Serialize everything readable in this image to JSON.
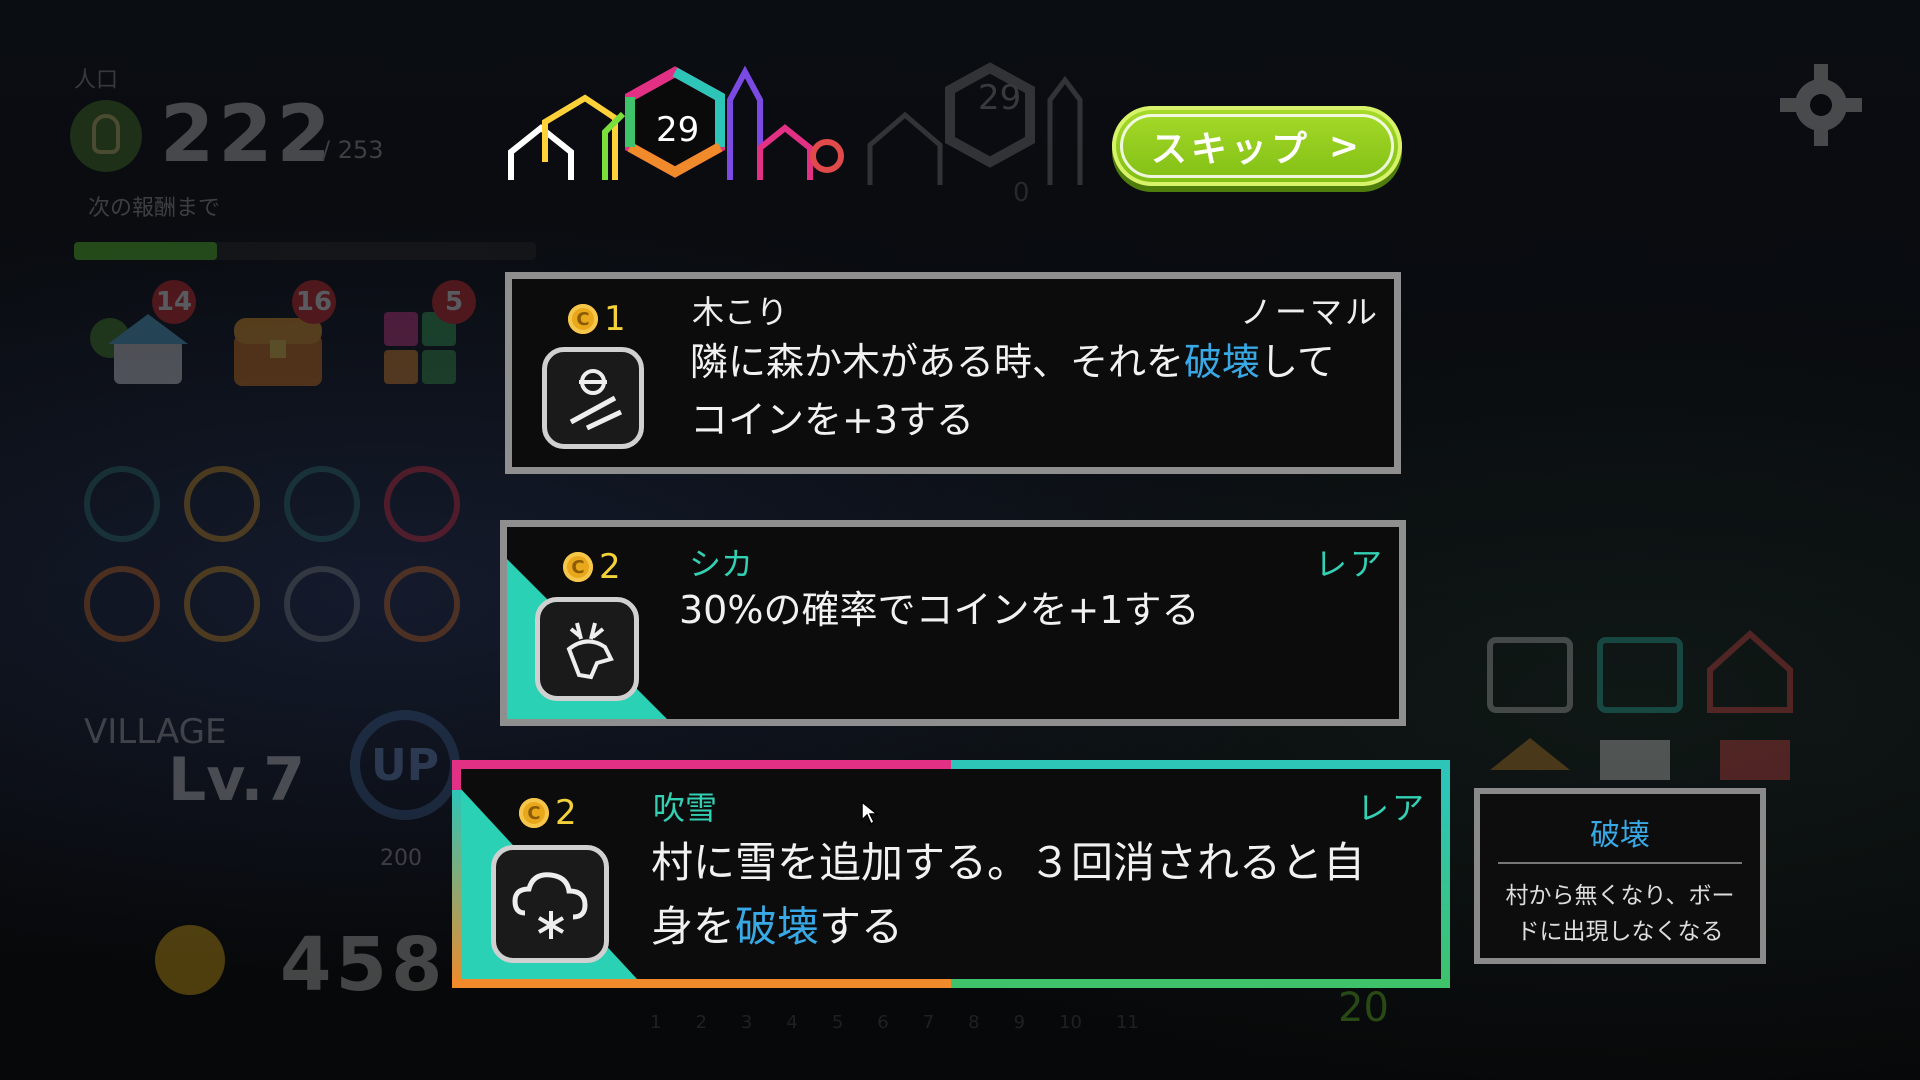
{
  "hud": {
    "population_label": "人口",
    "population_value": "222",
    "population_max": "/ 253",
    "next_reward_label": "次の報酬まで",
    "reward_progress": 0.31,
    "resource_badges": [
      "14",
      "16",
      "5"
    ],
    "village_label": "VILLAGE",
    "village_level": "Lv.7",
    "up_label": "UP",
    "up_cost": "200",
    "coins": "458",
    "crown_count": "0",
    "timeline_ticks": [
      "1",
      "2",
      "3",
      "4",
      "5",
      "6",
      "7",
      "8",
      "9",
      "10",
      "11"
    ],
    "side_coins": "20"
  },
  "header": {
    "level": "29",
    "next_level": "29",
    "skip_label": "スキップ",
    "skip_arrow": ">"
  },
  "cards": [
    {
      "cost": "1",
      "name": "木こり",
      "rarity": "ノーマル",
      "icon": "lumberjack-icon",
      "desc_parts": [
        "隣に森か木がある時、それを",
        "破壊",
        "して",
        "コインを+3する"
      ]
    },
    {
      "cost": "2",
      "name": "シカ",
      "rarity": "レア",
      "icon": "deer-icon",
      "desc": "30%の確率でコインを+1する"
    },
    {
      "cost": "2",
      "name": "吹雪",
      "rarity": "レア",
      "icon": "snow-cloud-icon",
      "desc_parts": [
        "村に雪を追加する。３回消されると自",
        "身を",
        "破壊",
        "する"
      ],
      "selected": true
    }
  ],
  "tooltip": {
    "title": "破壊",
    "body_line1": "村から無くなり、ボー",
    "body_line2": "ドに出現しなくなる"
  },
  "colors": {
    "accent_green": "#8fce1e",
    "rare_teal": "#2ad1b4",
    "keyword_blue": "#39a9e6",
    "coin_gold": "#e9a81b"
  }
}
